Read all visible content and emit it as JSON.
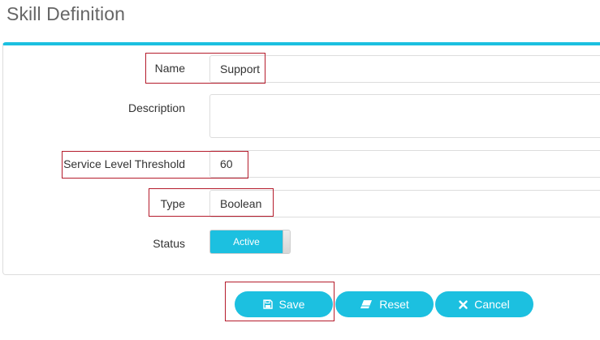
{
  "page": {
    "title": "Skill Definition"
  },
  "form": {
    "name": {
      "label": "Name",
      "value": "Support"
    },
    "description": {
      "label": "Description",
      "value": ""
    },
    "threshold": {
      "label": "Service Level Threshold",
      "value": "60"
    },
    "type": {
      "label": "Type",
      "value": "Boolean"
    },
    "status": {
      "label": "Status",
      "value": "Active",
      "active": true
    }
  },
  "actions": {
    "save_label": "Save",
    "reset_label": "Reset",
    "cancel_label": "Cancel"
  },
  "icons": {
    "save": "floppy-disk-icon",
    "reset": "eraser-icon",
    "cancel": "x-icon"
  },
  "colors": {
    "accent": "#1cc0e0",
    "highlight": "#b51c2c",
    "title": "#666666"
  }
}
